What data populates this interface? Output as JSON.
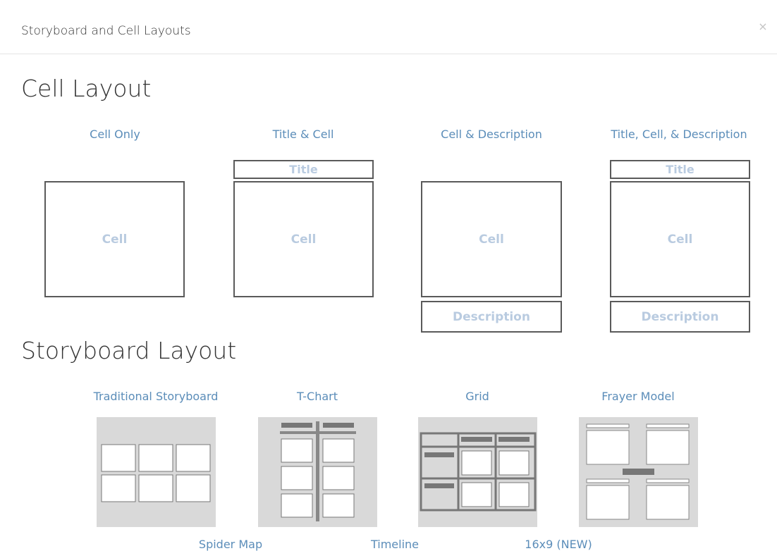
{
  "dialog": {
    "title": "Storyboard and Cell Layouts",
    "close_glyph": "×"
  },
  "cell_layout": {
    "heading": "Cell Layout",
    "options": [
      {
        "label": "Cell Only",
        "cell": "Cell"
      },
      {
        "label": "Title & Cell",
        "title": "Title",
        "cell": "Cell"
      },
      {
        "label": "Cell & Description",
        "cell": "Cell",
        "description": "Description"
      },
      {
        "label": "Title, Cell, & Description",
        "title": "Title",
        "cell": "Cell",
        "description": "Description"
      }
    ]
  },
  "storyboard_layout": {
    "heading": "Storyboard Layout",
    "options": [
      {
        "label": "Traditional Storyboard"
      },
      {
        "label": "T-Chart"
      },
      {
        "label": "Grid"
      },
      {
        "label": "Frayer Model"
      },
      {
        "label": "Spider Map"
      },
      {
        "label": "Timeline"
      },
      {
        "label": "16x9 (NEW)"
      }
    ]
  },
  "colors": {
    "link": "#5b8db9",
    "placeholder_text": "#b9cbe0",
    "box_border": "#5a5a5a",
    "thumb_bg": "#d9d9d9",
    "thumb_bar": "#777777"
  }
}
